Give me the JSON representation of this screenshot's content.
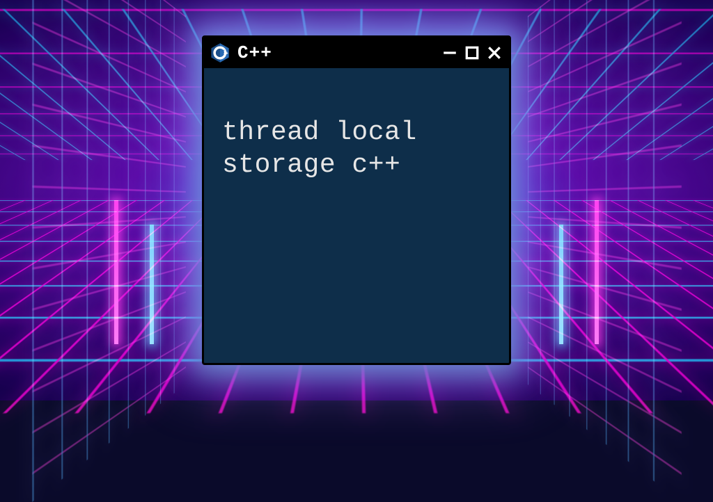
{
  "window": {
    "title": "C++",
    "icon": "cpp-logo-icon"
  },
  "content": {
    "text": "thread local\nstorage c++"
  },
  "colors": {
    "window_bg": "#0e2e4a",
    "titlebar_bg": "#000000",
    "text": "#e6e6e6",
    "neon_pink": "#ff3ad6",
    "neon_cyan": "#35d8ff"
  }
}
